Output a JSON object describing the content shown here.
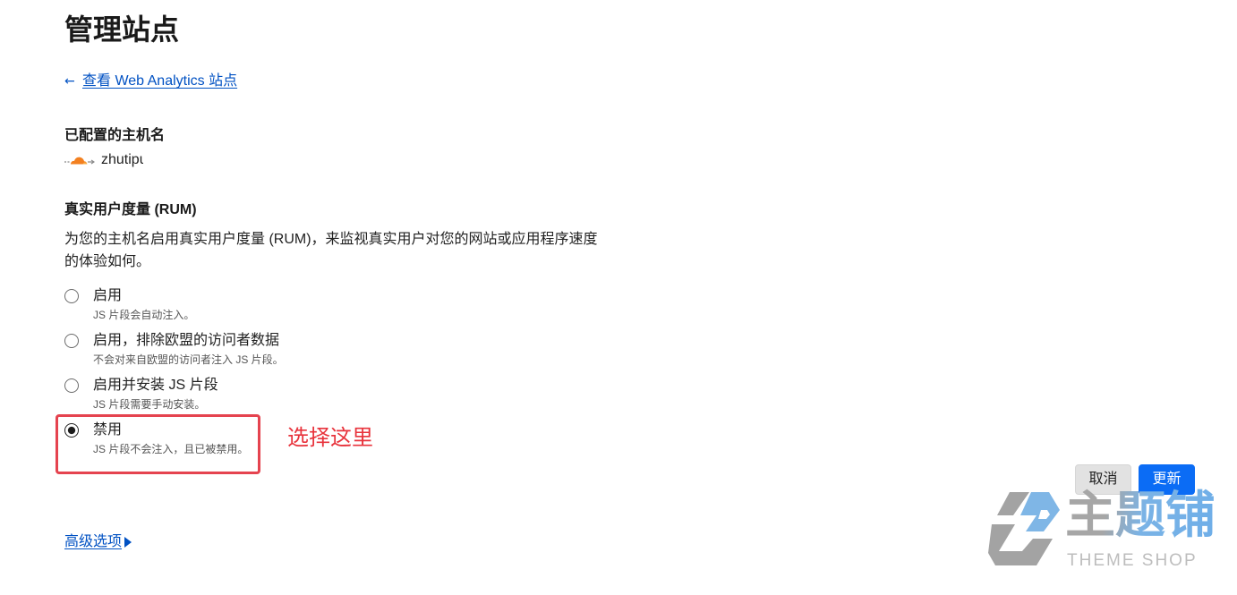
{
  "page": {
    "title": "管理站点"
  },
  "back_link": {
    "arrow": "←",
    "label": "查看 Web Analytics 站点",
    "icon": "arrow-left-icon"
  },
  "hostnames": {
    "heading": "已配置的主机名",
    "items": [
      {
        "name": "zhutipu",
        "icon": "cloudflare-proxied-cloud-icon"
      }
    ]
  },
  "rum": {
    "heading": "真实用户度量 (RUM)",
    "description": "为您的主机名启用真实用户度量 (RUM)，来监视真实用户对您的网站或应用程序速度的体验如何。",
    "options": [
      {
        "label": "启用",
        "hint": "JS 片段会自动注入。",
        "checked": false
      },
      {
        "label": "启用，排除欧盟的访问者数据",
        "hint": "不会对来自欧盟的访问者注入 JS 片段。",
        "checked": false
      },
      {
        "label": "启用并安装 JS 片段",
        "hint": "JS 片段需要手动安装。",
        "checked": false
      },
      {
        "label": "禁用",
        "hint": "JS 片段不会注入，且已被禁用。",
        "checked": true
      }
    ]
  },
  "annotation": {
    "text": "选择这里"
  },
  "actions": {
    "cancel_label": "取消",
    "update_label": "更新"
  },
  "advanced": {
    "label": "高级选项",
    "icon": "caret-right-icon"
  },
  "watermark": {
    "brand_cn": "主题铺",
    "brand_en": "THEME SHOP",
    "icon": "theme-shop-logo-icon"
  },
  "colors": {
    "link": "#0051c3",
    "primary_button": "#0b6cf5",
    "annotation_border": "#e5434f",
    "annotation_text": "#e8333c",
    "cloud": "#f38020"
  }
}
